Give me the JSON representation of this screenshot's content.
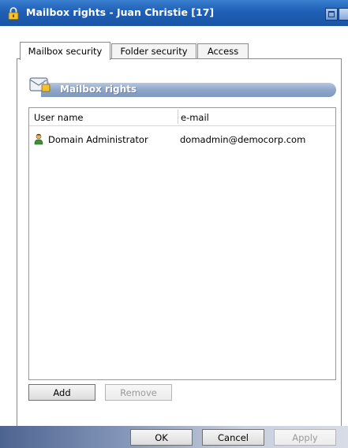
{
  "window": {
    "title": "Mailbox rights - Juan Christie [17]"
  },
  "tabs": [
    {
      "label": "Mailbox security",
      "active": true
    },
    {
      "label": "Folder security",
      "active": false
    },
    {
      "label": "Access",
      "active": false
    }
  ],
  "section": {
    "title": "Mailbox rights"
  },
  "list": {
    "columns": [
      "User name",
      "e-mail"
    ],
    "rows": [
      {
        "user": "Domain Administrator",
        "email": "domadmin@democorp.com"
      }
    ]
  },
  "actions": {
    "add_label": "Add",
    "remove_label": "Remove"
  },
  "dialog_buttons": {
    "ok_label": "OK",
    "cancel_label": "Cancel",
    "apply_label": "Apply"
  },
  "colors": {
    "titlebar": "#1f5fb5",
    "section_bar": "#8fa6c9"
  },
  "icons": {
    "title": "lock-icon",
    "section": "mailbox-icon",
    "user": "user-icon"
  }
}
